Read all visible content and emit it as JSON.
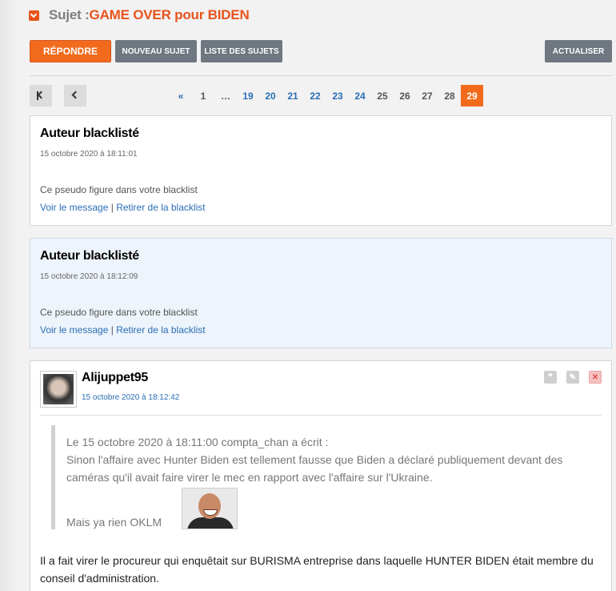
{
  "topic": {
    "prefix": "Sujet : ",
    "title": "GAME OVER pour BIDEN"
  },
  "toolbar": {
    "reply": "RÉPONDRE",
    "new_topic": "NOUVEAU SUJET",
    "topic_list": "LISTE DES SUJETS",
    "refresh": "ACTUALISER"
  },
  "pagination": {
    "pages": [
      {
        "label": "«",
        "kind": "link"
      },
      {
        "label": "1",
        "kind": "plain"
      },
      {
        "label": "…",
        "kind": "plain"
      },
      {
        "label": "19",
        "kind": "link"
      },
      {
        "label": "20",
        "kind": "link"
      },
      {
        "label": "21",
        "kind": "link"
      },
      {
        "label": "22",
        "kind": "link"
      },
      {
        "label": "23",
        "kind": "link"
      },
      {
        "label": "24",
        "kind": "link"
      },
      {
        "label": "25",
        "kind": "plain"
      },
      {
        "label": "26",
        "kind": "plain"
      },
      {
        "label": "27",
        "kind": "plain"
      },
      {
        "label": "28",
        "kind": "plain"
      },
      {
        "label": "29",
        "kind": "active"
      }
    ],
    "current": 29
  },
  "blacklisted": [
    {
      "author": "Auteur blacklisté",
      "date": "15 octobre 2020 à 18:11:01",
      "note": "Ce pseudo figure dans votre blacklist",
      "view": "Voir le message",
      "sep": " | ",
      "remove": "Retirer de la blacklist"
    },
    {
      "author": "Auteur blacklisté",
      "date": "15 octobre 2020 à 18:12:09",
      "note": "Ce pseudo figure dans votre blacklist",
      "view": "Voir le message",
      "sep": " | ",
      "remove": "Retirer de la blacklist"
    }
  ],
  "post": {
    "author": "Alijuppet95",
    "date": "15 octobre 2020 à 18:12:42",
    "quote": {
      "header": "Le 15 octobre 2020 à 18:11:00 compta_chan a écrit :",
      "line1": "Sinon l'affaire avec Hunter Biden est tellement fausse que Biden a déclaré publiquement devant des",
      "line2": "caméras qu'il avait faire virer le mec en rapport avec l'affaire sur l'Ukraine.",
      "line3": "Mais ya rien OKLM"
    },
    "body1": "Il a fait virer le procureur qui enquêtait sur BURISMA entreprise dans laquelle HUNTER BIDEN était membre du",
    "body2": "conseil d'administration."
  },
  "colors": {
    "accent": "#f26b1d",
    "link": "#2a6db5",
    "button_gray": "#6f7780"
  },
  "icons": [
    "collapse-icon",
    "first-page-icon",
    "previous-page-icon",
    "quote-icon",
    "edit-icon",
    "delete-icon"
  ]
}
